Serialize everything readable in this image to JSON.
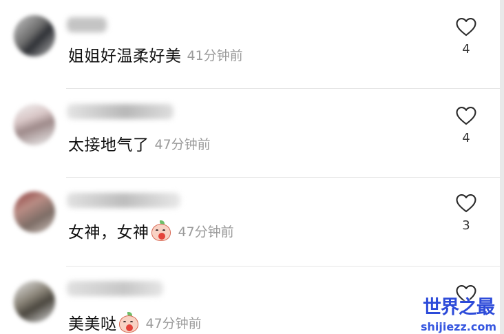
{
  "comments": [
    {
      "text": "姐姐好温柔好美",
      "time": "41分钟前",
      "likes": "4",
      "emoji": null
    },
    {
      "text": "太接地气了",
      "time": "47分钟前",
      "likes": "4",
      "emoji": null
    },
    {
      "text": "女神，女神",
      "time": "47分钟前",
      "likes": "3",
      "emoji": "peach-blush-emoji"
    },
    {
      "text": "美美哒",
      "time": "47分钟前",
      "likes": "",
      "emoji": "peach-blush-emoji"
    }
  ],
  "icons": {
    "like": "heart-outline-icon"
  },
  "watermark": {
    "title": "世界之最",
    "url": "shijiezz.com"
  },
  "colors": {
    "time_text": "#9a9a9a",
    "watermark_blue": "#2d4bd9",
    "divider": "#e6e6e6"
  }
}
